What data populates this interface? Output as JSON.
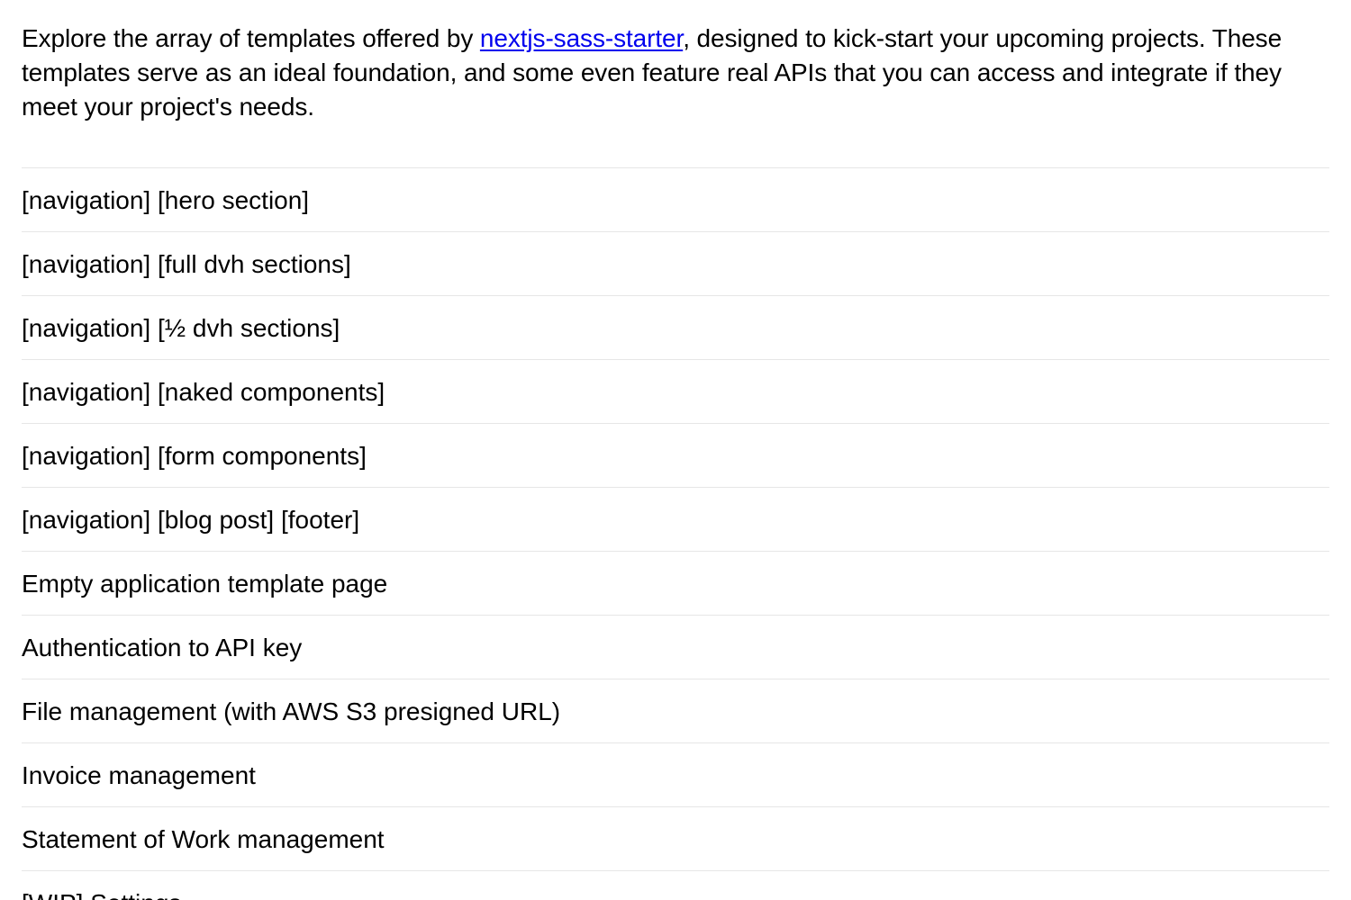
{
  "intro": {
    "text_before": "Explore the array of templates offered by ",
    "link_label": "nextjs-sass-starter",
    "text_after": ", designed to kick-start your upcoming projects. These templates serve as an ideal foundation, and some even feature real APIs that you can access and integrate if they meet your project's needs."
  },
  "templates": [
    {
      "label": "[navigation] [hero section]"
    },
    {
      "label": "[navigation] [full dvh sections]"
    },
    {
      "label": "[navigation] [½ dvh sections]"
    },
    {
      "label": "[navigation] [naked components]"
    },
    {
      "label": "[navigation] [form components]"
    },
    {
      "label": "[navigation] [blog post] [footer]"
    },
    {
      "label": "Empty application template page"
    },
    {
      "label": "Authentication to API key"
    },
    {
      "label": "File management (with AWS S3 presigned URL)"
    },
    {
      "label": "Invoice management"
    },
    {
      "label": "Statement of Work management"
    },
    {
      "label": "[WIP] Settings"
    }
  ],
  "colors": {
    "link": "#0000ee",
    "divider": "#e6e6e6",
    "text": "#000000",
    "background": "#ffffff"
  }
}
